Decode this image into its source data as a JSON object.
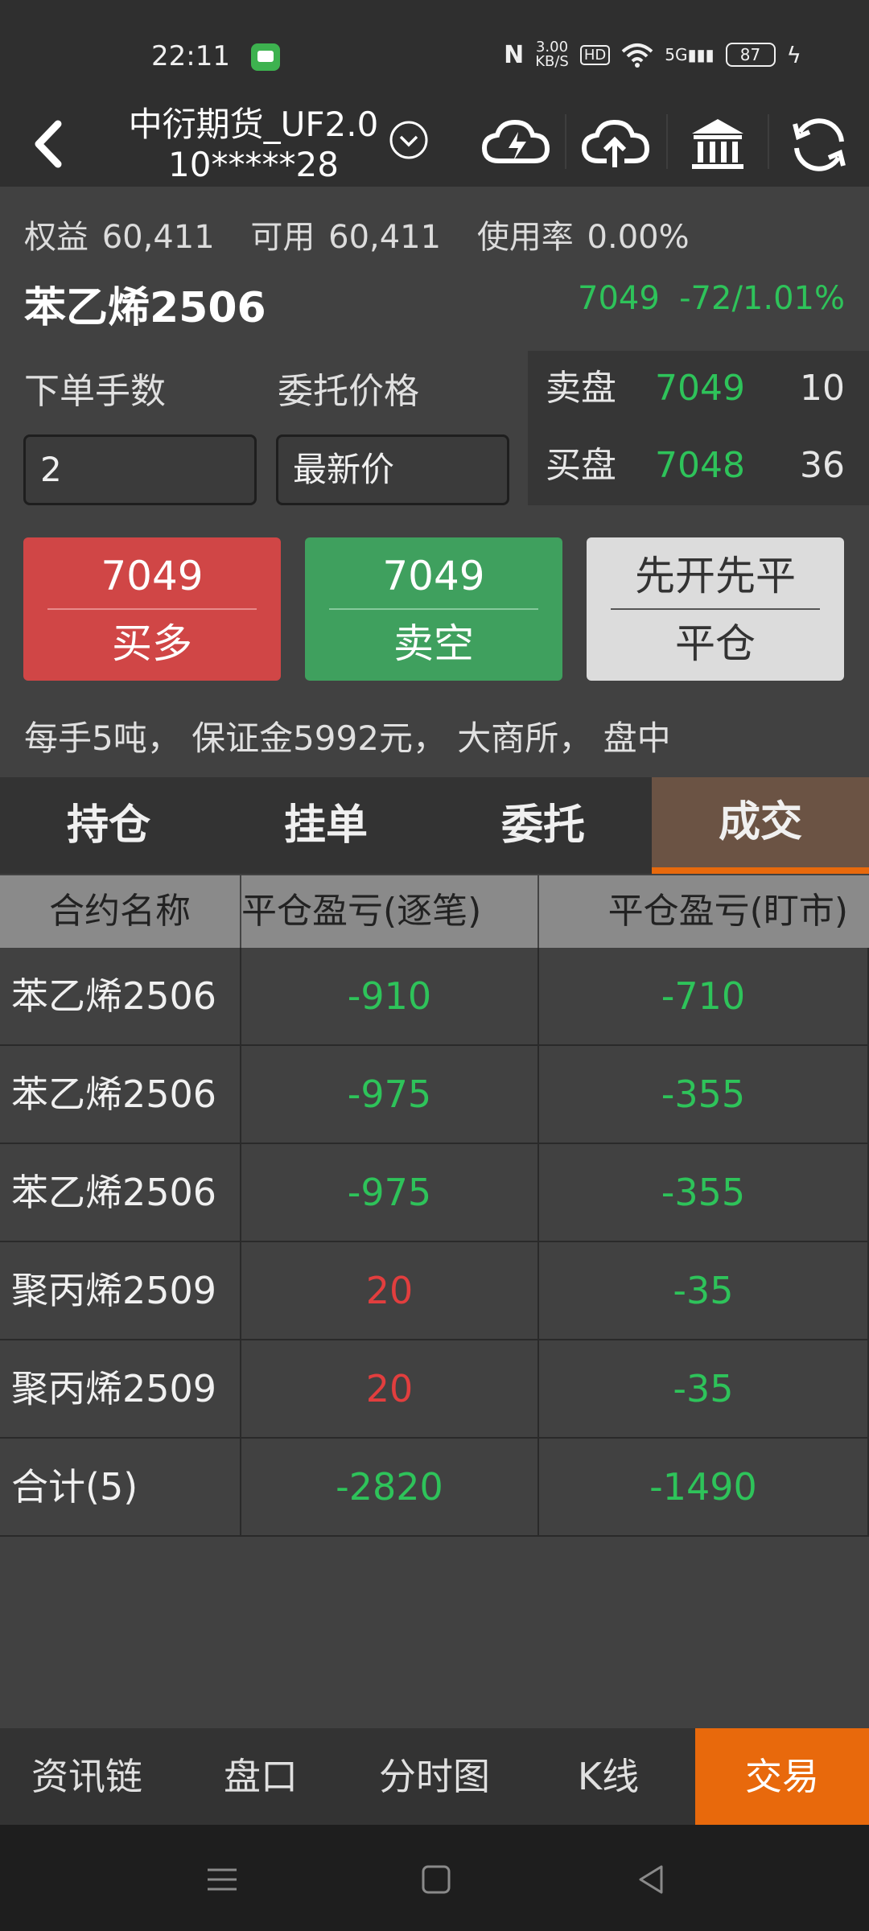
{
  "status_bar": {
    "time": "22:11",
    "net_speed_value": "3.00",
    "net_speed_unit": "KB/S",
    "hd_badge": "HD",
    "signal": "5G",
    "battery": "87"
  },
  "header": {
    "account_title_line1": "中衍期货_UF2.0",
    "account_title_line2": "10*****28"
  },
  "account": {
    "equity": "权益 60,411",
    "available": "可用 60,411",
    "usage": "使用率 0.00%"
  },
  "contract": {
    "name": "苯乙烯2506",
    "last_price": "7049",
    "change": "-72/1.01%"
  },
  "order_form": {
    "qty_label": "下单手数",
    "price_label": "委托价格",
    "qty_value": "2",
    "price_value": "最新价"
  },
  "orderbook": {
    "ask": {
      "label": "卖盘",
      "price": "7049",
      "volume": "10"
    },
    "bid": {
      "label": "买盘",
      "price": "7048",
      "volume": "36"
    }
  },
  "buttons": {
    "buy": {
      "price": "7049",
      "label": "买多"
    },
    "sell": {
      "price": "7049",
      "label": "卖空"
    },
    "close": {
      "mode": "先开先平",
      "label": "平仓"
    }
  },
  "info_line": "每手5吨， 保证金5992元， 大商所， 盘中",
  "tabs": [
    "持仓",
    "挂单",
    "委托",
    "成交"
  ],
  "table": {
    "headers": [
      "合约名称",
      "平仓盈亏(逐笔)",
      "平仓盈亏(盯市)"
    ],
    "rows": [
      {
        "name": "苯乙烯2506",
        "pnl_trade": "-910",
        "pnl_mtm": "-710"
      },
      {
        "name": "苯乙烯2506",
        "pnl_trade": "-975",
        "pnl_mtm": "-355"
      },
      {
        "name": "苯乙烯2506",
        "pnl_trade": "-975",
        "pnl_mtm": "-355"
      },
      {
        "name": "聚丙烯2509",
        "pnl_trade": "20",
        "pnl_mtm": "-35"
      },
      {
        "name": "聚丙烯2509",
        "pnl_trade": "20",
        "pnl_mtm": "-35"
      },
      {
        "name": "合计(5)",
        "pnl_trade": "-2820",
        "pnl_mtm": "-1490"
      }
    ]
  },
  "bottom_nav": [
    "资讯链",
    "盘口",
    "分时图",
    "K线",
    "交易"
  ],
  "colors": {
    "up": "#e23e3e",
    "down": "#2ec35a",
    "accent": "#e8690c",
    "buy": "#d04646",
    "sell": "#3fa05e"
  }
}
